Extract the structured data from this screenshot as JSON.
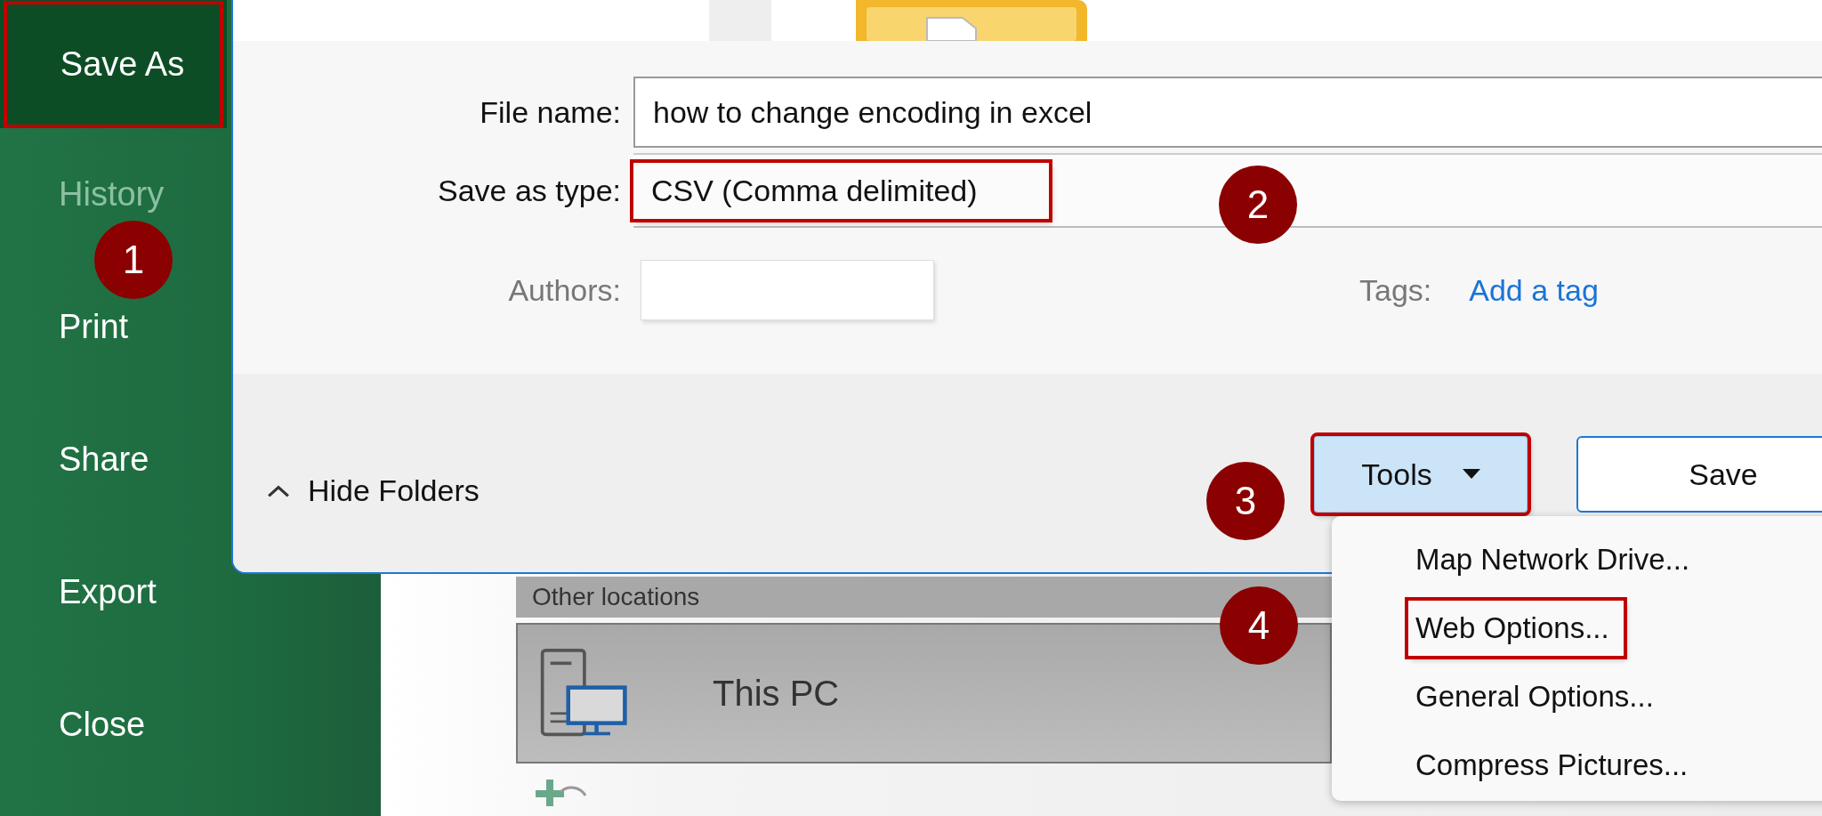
{
  "sidebar": {
    "items": [
      {
        "label": "Save As",
        "selected": true,
        "disabled": false,
        "annotated": true
      },
      {
        "label": "History",
        "selected": false,
        "disabled": true,
        "annotated": false
      },
      {
        "label": "Print",
        "selected": false,
        "disabled": false,
        "annotated": false
      },
      {
        "label": "Share",
        "selected": false,
        "disabled": false,
        "annotated": false
      },
      {
        "label": "Export",
        "selected": false,
        "disabled": false,
        "annotated": false
      },
      {
        "label": "Close",
        "selected": false,
        "disabled": false,
        "annotated": false
      }
    ]
  },
  "backstage": {
    "section_heading": "Other locations",
    "places": [
      {
        "label": "This PC"
      }
    ]
  },
  "dialog": {
    "file_name": {
      "label": "File name:",
      "value": "how to change encoding in excel"
    },
    "save_as_type": {
      "label": "Save as type:",
      "value": "CSV (Comma delimited)",
      "annotated": true
    },
    "authors": {
      "label": "Authors:"
    },
    "tags": {
      "label": "Tags:",
      "link": "Add a tag"
    },
    "hide_folders": "Hide Folders",
    "tools_button": {
      "label": "Tools",
      "annotated": true
    },
    "save_button": "Save"
  },
  "tools_menu": {
    "items": [
      {
        "label": "Map Network Drive...",
        "annotated": false
      },
      {
        "label": "Web Options...",
        "annotated": true
      },
      {
        "label": "General Options...",
        "annotated": false
      },
      {
        "label": "Compress Pictures...",
        "annotated": false
      }
    ]
  },
  "steps": [
    "1",
    "2",
    "3",
    "4"
  ]
}
